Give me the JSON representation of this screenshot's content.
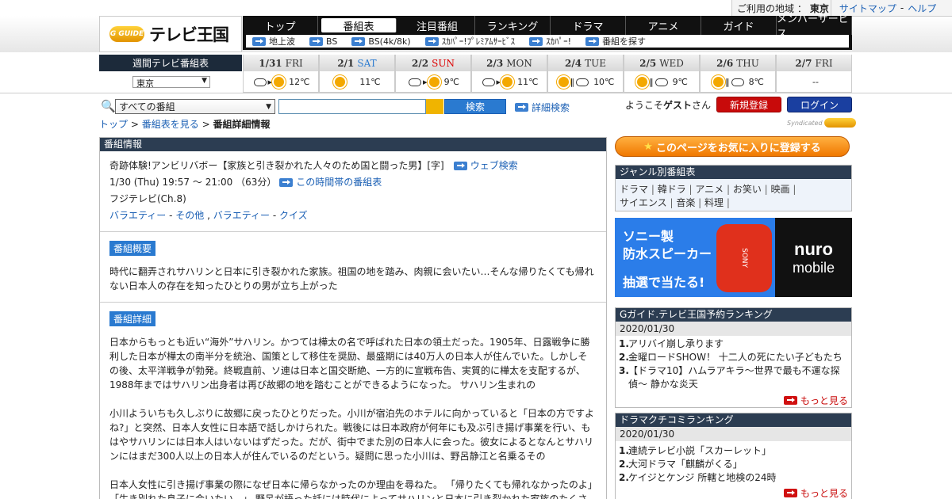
{
  "util": {
    "area_label": "ご利用の地域 ：",
    "area": "東京",
    "sitemap": "サイトマップ",
    "sep": "-",
    "help": "ヘルプ"
  },
  "logo": {
    "g": "G GUIDE",
    "title": "テレビ王国"
  },
  "nav": [
    "トップ",
    "番組表",
    "注目番組",
    "ランキング",
    "ドラマ",
    "アニメ",
    "ガイド",
    "メンバーサービス"
  ],
  "subnav": [
    "地上波",
    "BS",
    "BS(4k/8k)",
    "ｽｶﾊﾟｰ!ﾌﾟﾚﾐｱﾑｻｰﾋﾞｽ",
    "ｽｶﾊﾟｰ!",
    "番組を探す"
  ],
  "week": {
    "label": "週間テレビ番組表",
    "region": "東京",
    "days": [
      {
        "d": "1/31",
        "w": "FRI",
        "cls": "",
        "temp": "12℃",
        "wx": "cloud-sun"
      },
      {
        "d": "2/1",
        "w": "SAT",
        "cls": "sat",
        "temp": "11℃",
        "wx": "sun"
      },
      {
        "d": "2/2",
        "w": "SUN",
        "cls": "sun",
        "temp": "9℃",
        "wx": "cloud-sun"
      },
      {
        "d": "2/3",
        "w": "MON",
        "cls": "",
        "temp": "11℃",
        "wx": "cloud-sun"
      },
      {
        "d": "2/4",
        "w": "TUE",
        "cls": "",
        "temp": "10℃",
        "wx": "sun-cloud"
      },
      {
        "d": "2/5",
        "w": "WED",
        "cls": "",
        "temp": "9℃",
        "wx": "sun-cloud"
      },
      {
        "d": "2/6",
        "w": "THU",
        "cls": "",
        "temp": "8℃",
        "wx": "sun-cloud"
      },
      {
        "d": "2/7",
        "w": "FRI",
        "cls": "",
        "temp": "--",
        "wx": ""
      }
    ]
  },
  "search": {
    "category": "すべての番組",
    "button": "検索",
    "advanced": "詳細検索"
  },
  "user": {
    "welcome_pre": "ようこそ",
    "guest": "ゲスト",
    "welcome_post": "さん",
    "register": "新規登録",
    "login": "ログイン",
    "syndicated": "Syndicated"
  },
  "breadcrumb": {
    "top": "トップ",
    "sep1": ">",
    "schedule": "番組表を見る",
    "sep2": ">",
    "current": "番組詳細情報"
  },
  "program": {
    "section": "番組情報",
    "title": "奇跡体験!アンビリバボー【家族と引き裂かれた人々のため国と闘った男】[字]",
    "web_search": "ウェブ検索",
    "time": "1/30 (Thu) 19:57 ～ 21:00 （63分）",
    "time_link": "この時間帯の番組表",
    "channel": "フジテレビ(Ch.8)",
    "genres": [
      {
        "a": "バラエティー",
        "sep": " - ",
        "b": "その他"
      },
      {
        "a": "バラエティー",
        "sep": " - ",
        "b": "クイズ"
      }
    ],
    "summary_label": "番組概要",
    "summary": "時代に翻弄されサハリンと日本に引き裂かれた家族。祖国の地を踏み、肉親に会いたい…そんな帰りたくても帰れない日本人の存在を知ったひとりの男が立ち上がった",
    "detail_label": "番組詳細",
    "detail1": "日本からもっとも近い“海外”サハリン。かつては樺太の名で呼ばれた日本の領土だった。1905年、日露戦争に勝利した日本が樺太の南半分を統治、国策として移住を奨励、最盛期には40万人の日本人が住んでいた。しかしその後、太平洋戦争が勃発。終戦直前、ソ連は日本と国交断絶、一方的に宣戦布告、実質的に樺太を支配するが、1988年まではサハリン出身者は再び故郷の地を踏むことができるようになった。 サハリン生まれの",
    "detail2": "小川よういちも久しぶりに故郷に戻ったひとりだった。小川が宿泊先のホテルに向かっていると「日本の方ですよね?」と突然、日本人女性に日本語で話しかけられた。戦後には日本政府が何年にも及ぶ引き揚げ事業を行い、もはやサハリンには日本人はいないはずだった。だが、街中でまた別の日本人に会った。彼女によるとなんとサハリンにはまだ300人以上の日本人が住んでいるのだという。疑問に思った小川は、野呂静江と名乗るその",
    "detail3": "日本人女性に引き揚げ事業の際になぜ日本に帰らなかったのか理由を尋ねた。 「帰りたくても帰れなかったのよ」「生き別れた息子に会いたい…」 野呂が語った話には時代によってサハリンと日本に引き裂かれた家族のたくさんの葛藤があった。 胸を痛めた小川は必ず息子さんに会えるようにしますと約束。しかし国との見解の食い"
  },
  "fav": "このページをお気に入りに登録する",
  "genre_box": {
    "title": "ジャンル別番組表",
    "line1": [
      "ドラマ",
      "韓ドラ",
      "アニメ",
      "お笑い",
      "映画"
    ],
    "line2": [
      "サイエンス",
      "音楽",
      "料理"
    ]
  },
  "ad": {
    "l1": "ソニー製",
    "l2": "防水スピーカー",
    "l3": "抽選で当たる!",
    "brand1": "nuro",
    "brand2": "mobile",
    "speaker_text": "SONY"
  },
  "rank1": {
    "title": "Gガイド.テレビ王国予約ランキング",
    "date": "2020/01/30",
    "items": [
      {
        "n": "1.",
        "t": "アリバイ崩し承ります"
      },
      {
        "n": "2.",
        "t": "金曜ロードSHOW！ 十二人の死にたい子どもたち"
      },
      {
        "n": "3.",
        "t": "【ドラマ10】ハムラアキラ〜世界で最も不運な探偵〜 静かな炎天"
      }
    ],
    "more": "もっと見る"
  },
  "rank2": {
    "title": "ドラマクチコミランキング",
    "date": "2020/01/30",
    "items": [
      {
        "n": "1.",
        "t": "連続テレビ小説「スカーレット」"
      },
      {
        "n": "2.",
        "t": "大河ドラマ「麒麟がくる」"
      },
      {
        "n": "2.",
        "t": "ケイジとケンジ 所轄と地検の24時"
      }
    ],
    "more": "もっと見る"
  }
}
